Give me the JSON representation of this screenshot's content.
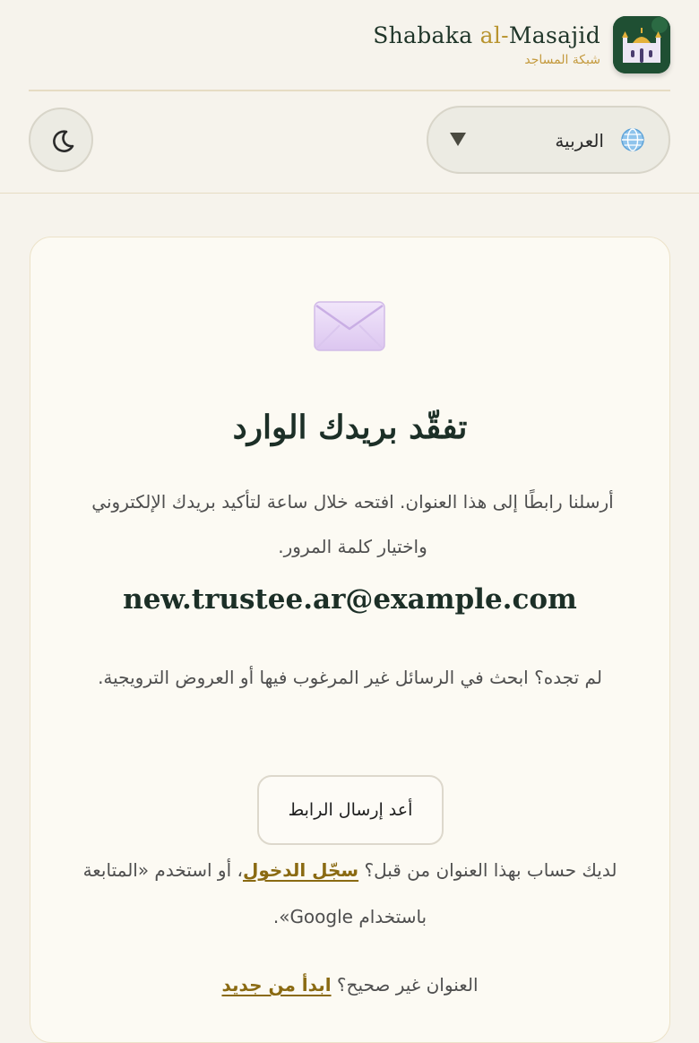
{
  "brand": {
    "name_part1": "Shabaka ",
    "name_accent": "al-",
    "name_part2": "Masajid",
    "subtitle": "شبكة المساجد",
    "logo_icon": "mosque-icon"
  },
  "language_select": {
    "selected": "العربية",
    "icon": "globe-icon"
  },
  "theme_toggle": {
    "icon": "moon-icon"
  },
  "card": {
    "icon": "envelope-icon",
    "title": "تفقّد بريدك الوارد",
    "description": "أرسلنا رابطًا إلى هذا العنوان. افتحه خلال ساعة لتأكيد بريدك الإلكتروني واختيار كلمة المرور.",
    "email": "new.trustee.ar@example.com",
    "spam_hint": "لم تجده؟ ابحث في الرسائل غير المرغوب فيها أو العروض الترويجية.",
    "resend_label": "أعد إرسال الرابط",
    "account_hint_before": "لديك حساب بهذا العنوان من قبل؟ ",
    "sign_in_link": "سجّل الدخول",
    "account_hint_after": "، أو استخدم «المتابعة باستخدام Google».",
    "wrong_hint": "العنوان غير صحيح؟ ",
    "start_over_link": "ابدأ من جديد"
  },
  "colors": {
    "page_bg": "#f6f3ec",
    "card_bg": "#fcfaf3",
    "brand_green": "#1f4f33",
    "accent_gold": "#b8942f",
    "link": "#8a6a12"
  }
}
